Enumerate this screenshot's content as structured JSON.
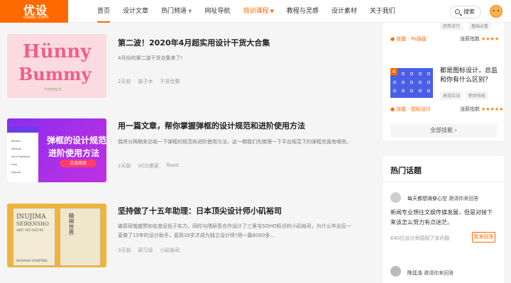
{
  "header": {
    "logo_text": "优设",
    "logo_sub": "uisdc.com",
    "nav": [
      {
        "label": "首页",
        "caret": false
      },
      {
        "label": "设计文章",
        "caret": false
      },
      {
        "label": "热门频道",
        "caret": true
      },
      {
        "label": "网址导航",
        "caret": false
      },
      {
        "label": "培训课程",
        "caret": true
      },
      {
        "label": "教程与灵感",
        "caret": false
      },
      {
        "label": "设计素材",
        "caret": false
      },
      {
        "label": "关于我们",
        "caret": false
      }
    ],
    "search_label": "搜索"
  },
  "articles": [
    {
      "title": "第二波！2020年4月超实用设计干货大合集",
      "desc": "4月份的第二波干货合集来了!",
      "time": "2天前",
      "author": "路子木",
      "tags": [
        "干货合集"
      ],
      "thumb_text": [
        "Hünny",
        "Bummy",
        "TYPEFACE"
      ]
    },
    {
      "title": "用一篇文章，帮你掌握弹框的设计规范和进阶使用方法",
      "desc": "我将分两期来总结一下弹框的规范和进阶使用方法，这一期我们先梳理一下平台规范下的弹框究竟有哪些。",
      "time": "2天前",
      "author": "UCD墨家",
      "tags": [
        "Toast"
      ],
      "thumb_text": [
        "弹框的设计规范",
        "进阶使用方法",
        "点击阅读"
      ],
      "phone_lines": [
        "Refresh",
        "Settings",
        "Send Feedback",
        "Help",
        "Signout"
      ]
    },
    {
      "title": "坚持做了十五年助理：日本顶尖设计师小矶裕司",
      "desc": "被原研哉盛赞如名度远低于实力，同时与隈研吾合作设计了三里屯SOHO标识的小矶裕司，为什么毕业后一直做了15年的设计助手，直到39岁才成为独立设计师?用一篇8000多...",
      "time": "3天前",
      "author": "研习设",
      "tags": [
        "小矶裕司"
      ],
      "thumb_text": [
        "INUJIMA",
        "SEIRENSHO",
        "ART MUSEUM",
        "ROMAN EMPIRE",
        "精神世界"
      ]
    }
  ],
  "sidebar": {
    "top_tags": [
      "趋势流行",
      "基础必看"
    ],
    "course1": {
      "label": "技能 · Ps插画",
      "index_label": "涨薪指数",
      "stars": "★★★★"
    },
    "course2": {
      "num": "4",
      "title": "都是图标设计，总监和你有什么区别？",
      "tags": [
        "高效实战",
        "职场技能"
      ],
      "label": "技能 · 图标设计",
      "index_label": "涨薪指数",
      "stars": "★★★★★"
    },
    "all_skills": "全部技能",
    "hot_topics": {
      "heading": "热门话题",
      "items": [
        {
          "user": "每天都想骑穿心空",
          "action": "邀请你来回答",
          "question": "新闻专业想往文娱传媒发展，但是对接下来该怎么努力有点迷茫。",
          "meta": "640位设计师围观了该问题",
          "answer_label": "我来回答"
        },
        {
          "user": "陈廷浩",
          "action": "邀请你来回答"
        }
      ]
    }
  }
}
